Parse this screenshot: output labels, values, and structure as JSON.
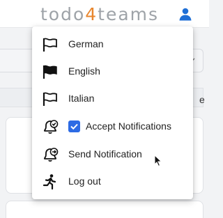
{
  "header": {
    "logo_part1": "todo",
    "logo_accent": "4",
    "logo_part2": "teams",
    "user_icon": "user-icon",
    "accent_color": "#e8862d",
    "user_icon_color": "#1f6fd6"
  },
  "background": {
    "partial_letter": "e"
  },
  "menu": {
    "items": [
      {
        "label": "German",
        "icon": "flag-outline-icon"
      },
      {
        "label": "English",
        "icon": "flag-filled-icon"
      },
      {
        "label": "Italian",
        "icon": "flag-outline-icon"
      },
      {
        "label": "Accept Notifications",
        "icon": "bell-check-icon",
        "checkbox": true,
        "checked": true
      },
      {
        "label": "Send Notification",
        "icon": "bell-send-icon"
      },
      {
        "label": "Log out",
        "icon": "running-person-icon"
      }
    ],
    "checkbox_color": "#2d6be4"
  }
}
